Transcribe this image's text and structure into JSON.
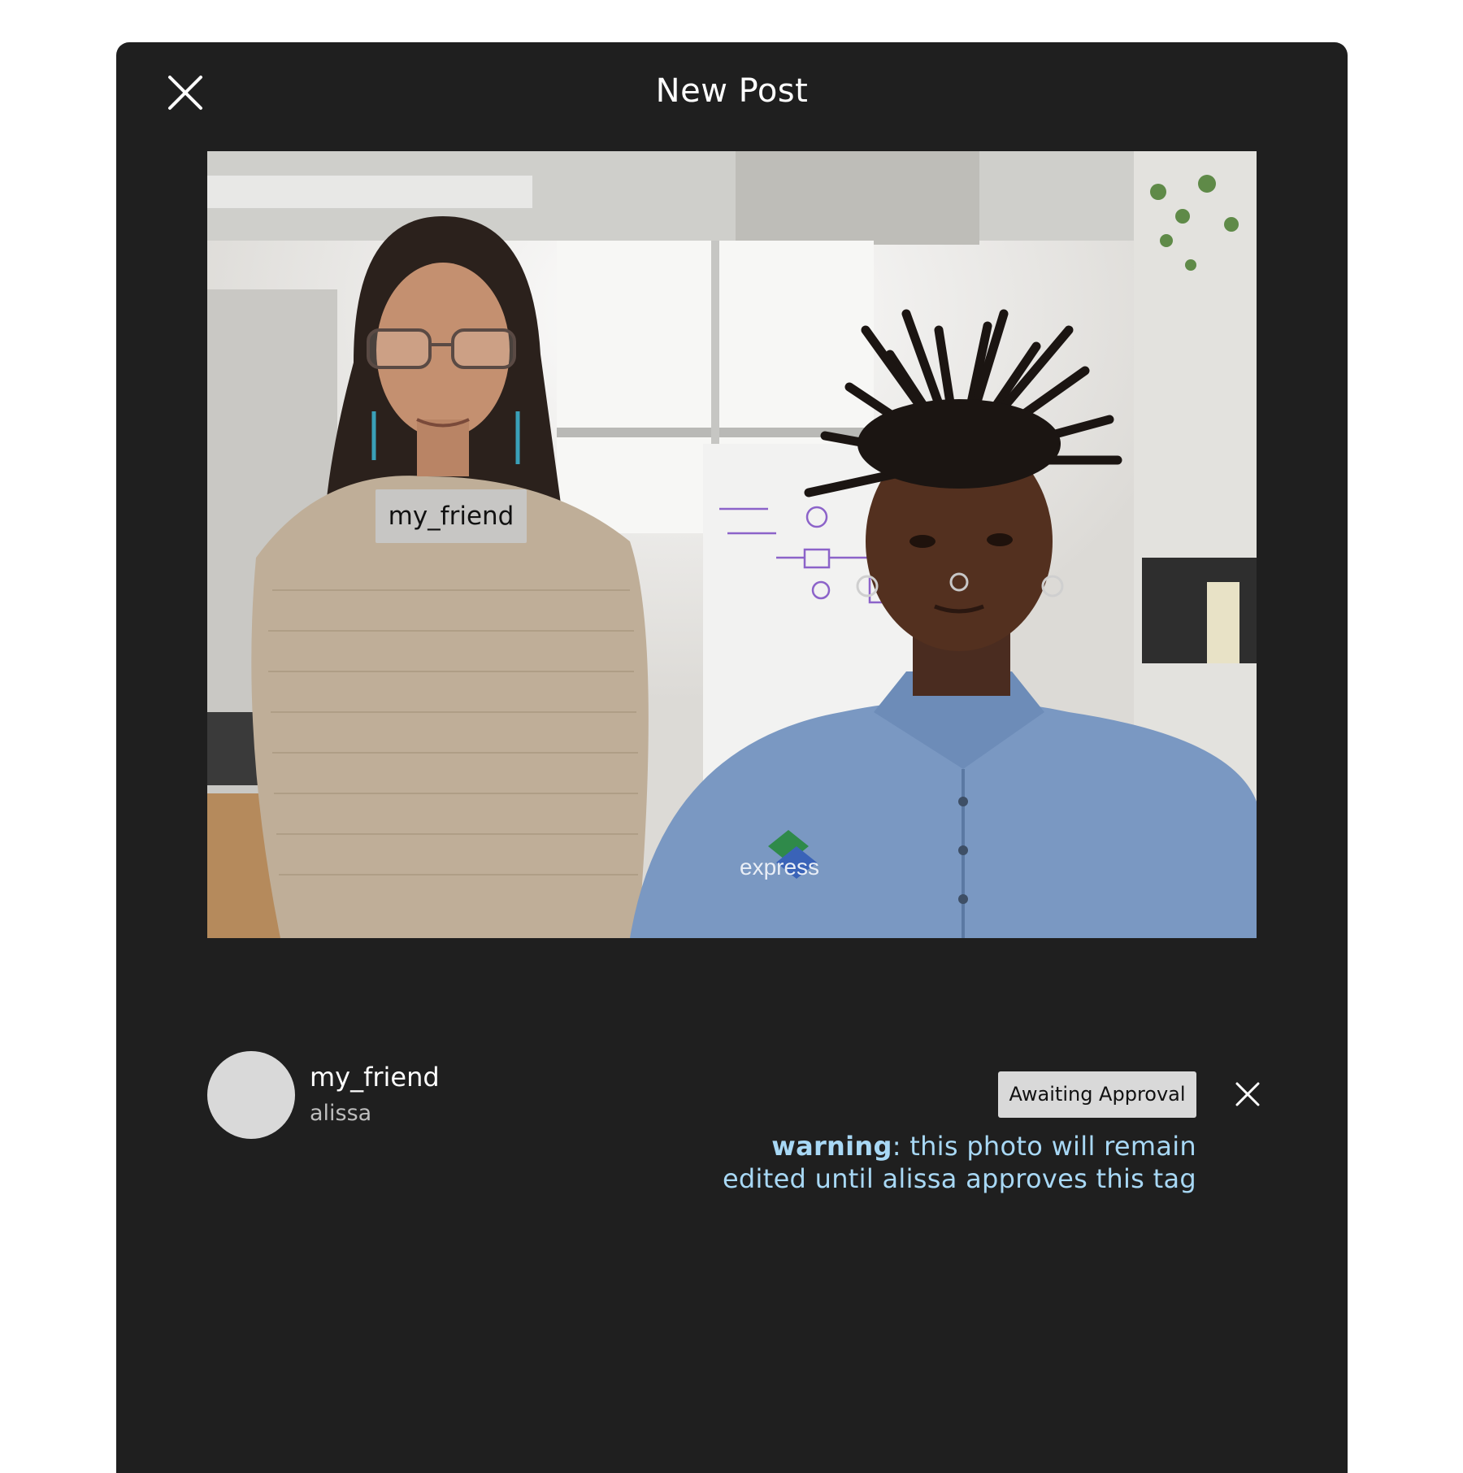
{
  "dialog": {
    "title": "New Post",
    "close_icon": "close-icon"
  },
  "photo": {
    "tag_label": "my_friend",
    "shirt_text": "express"
  },
  "tagged_user": {
    "username": "my_friend",
    "name": "alissa",
    "status": "Awaiting Approval",
    "remove_icon": "close-icon"
  },
  "warning": {
    "prefix": "warning",
    "line1": ": this photo will remain",
    "line2": "edited until alissa approves this tag"
  },
  "colors": {
    "panel_bg": "#1f1f1f",
    "warning_text": "#a8d8f5",
    "badge_bg": "#d9d9d9",
    "avatar_bg": "#d9d9d9"
  }
}
